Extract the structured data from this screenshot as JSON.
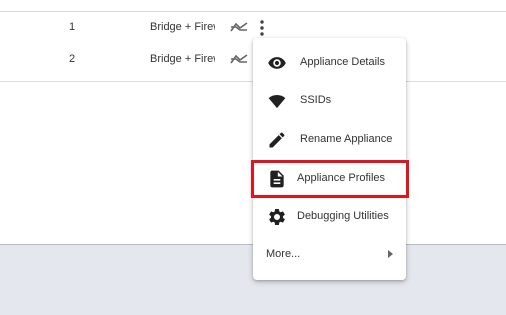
{
  "table": {
    "rows": [
      {
        "number": "1",
        "mode": "Bridge + Firewall",
        "trend_icon": "trending-flat-icon"
      },
      {
        "number": "2",
        "mode": "Bridge + Firewall",
        "trend_icon": "trending-flat-icon"
      }
    ]
  },
  "menu": {
    "items": [
      {
        "label": "Appliance Details",
        "icon": "eye-icon"
      },
      {
        "label": "SSIDs",
        "icon": "wifi-icon"
      },
      {
        "label": "Rename Appliance",
        "icon": "pencil-icon"
      },
      {
        "label": "Appliance Profiles",
        "icon": "document-icon",
        "highlighted": true
      },
      {
        "label": "Debugging Utilities",
        "icon": "gear-icon"
      },
      {
        "label": "More...",
        "icon": "chevron-right-icon"
      }
    ]
  },
  "colors": {
    "highlight": "#e0151d",
    "icon": "#212121",
    "text": "#333333",
    "background": "#e4e7ee"
  }
}
